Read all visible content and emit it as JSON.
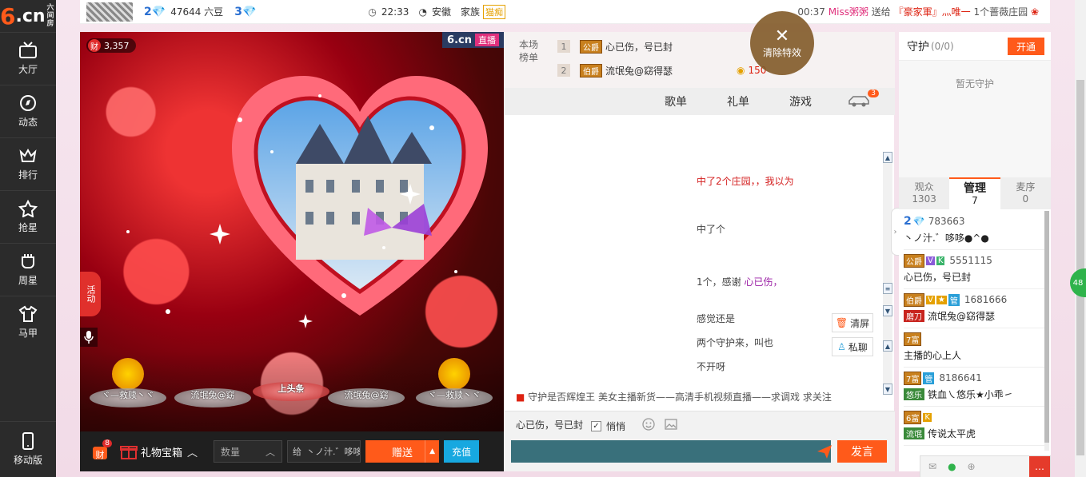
{
  "logo": {
    "six": "6",
    "cn": ".cn",
    "brand": "六间房"
  },
  "nav": [
    {
      "label": "大厅",
      "icon": "tv-icon"
    },
    {
      "label": "动态",
      "icon": "compass-icon"
    },
    {
      "label": "排行",
      "icon": "crown-icon"
    },
    {
      "label": "抢星",
      "icon": "star-icon"
    },
    {
      "label": "周星",
      "icon": "cup-icon"
    },
    {
      "label": "马甲",
      "icon": "shirt-icon"
    }
  ],
  "mobile": {
    "label": "移动版"
  },
  "top": {
    "level": "2",
    "beans": "47644 六豆",
    "level2": "3",
    "time": "22:33",
    "location": "安徽",
    "family_label": "家族",
    "family_tag": "猫痴",
    "marquee_time": "00:37",
    "marquee_user": "Miss粥粥",
    "marquee_action": "送给",
    "marquee_target": "『豪家軍』灬唯一",
    "marquee_gift": "1个蔷薇庄园"
  },
  "stage": {
    "wealth": "3,357",
    "wealth_icon": "财",
    "live_brand": "6.cn",
    "live_tag": "直播",
    "activity": "活动",
    "podiums": [
      "ヾ—救赎丶ヾ",
      "流氓兔@窈",
      "上头条",
      "流氓兔@窈",
      "ヾ—救赎丶ヾ"
    ]
  },
  "giftbar": {
    "cai_badge": "8",
    "cai_label": "财",
    "gift_box": "礼物宝箱",
    "qty_placeholder": "数量",
    "to_prefix": "给",
    "to_user": "丶ノ汁.゛哆哆",
    "send": "赠送",
    "recharge": "充值"
  },
  "rank": {
    "title": "本场榜单",
    "rows": [
      {
        "num": "1",
        "tag": "公爵",
        "name": "心已伤，号已封"
      },
      {
        "num": "2",
        "tag": "伯爵",
        "name": "流氓兔@窈得瑟",
        "score": "150"
      }
    ]
  },
  "tabs": [
    "歌单",
    "礼单",
    "游戏"
  ],
  "car_badge": "3",
  "clear_effects": "清除特效",
  "messages": {
    "m1_prefix": "中了2个庄园，，我以为",
    "m2": "中了个",
    "m3_a": "1个，感谢",
    "m3_user": "心已伤，",
    "m4": "感觉还是",
    "m5": "两个守护来，叫也",
    "m6": "不开呀"
  },
  "chat_buttons": {
    "clear": "清屏",
    "private": "私聊"
  },
  "notice": {
    "prefix": "守护是否辉煌王",
    "text": "美女主播新货——高清手机视频直播——求调戏 求关注"
  },
  "input": {
    "to_user": "心已伤，号已封",
    "private_label": "悄悄",
    "post": "发言"
  },
  "guard": {
    "title": "守护",
    "count": "(0/0)",
    "open": "开通",
    "empty": "暂无守护"
  },
  "rtabs": [
    {
      "label": "观众",
      "count": "1303"
    },
    {
      "label": "管理",
      "count": "7"
    },
    {
      "label": "麦序",
      "count": "0"
    }
  ],
  "users": [
    {
      "level": "2",
      "id": "783663",
      "name": "丶ノ汁.゛哆哆●^●"
    },
    {
      "badge": "公爵",
      "id": "5551115",
      "name": "心已伤，号已封"
    },
    {
      "badge": "伯爵",
      "id": "1681666",
      "fan": "磨刀",
      "name": "流氓兔@窈得瑟"
    },
    {
      "badge": "7富",
      "id": "",
      "name": "主播的心上人"
    },
    {
      "badge": "7富",
      "id": "8186641",
      "fan": "悠乐",
      "name": "铁血㇏悠乐★小乖㇀"
    },
    {
      "badge": "6富",
      "id": "",
      "fan": "流氓",
      "name": "传说太平虎"
    }
  ],
  "float": {
    "green": "48"
  },
  "colors": {
    "accent": "#ff5a1a",
    "nav": "#2b2b2b",
    "blue": "#17a8e0",
    "input": "#39707b"
  }
}
